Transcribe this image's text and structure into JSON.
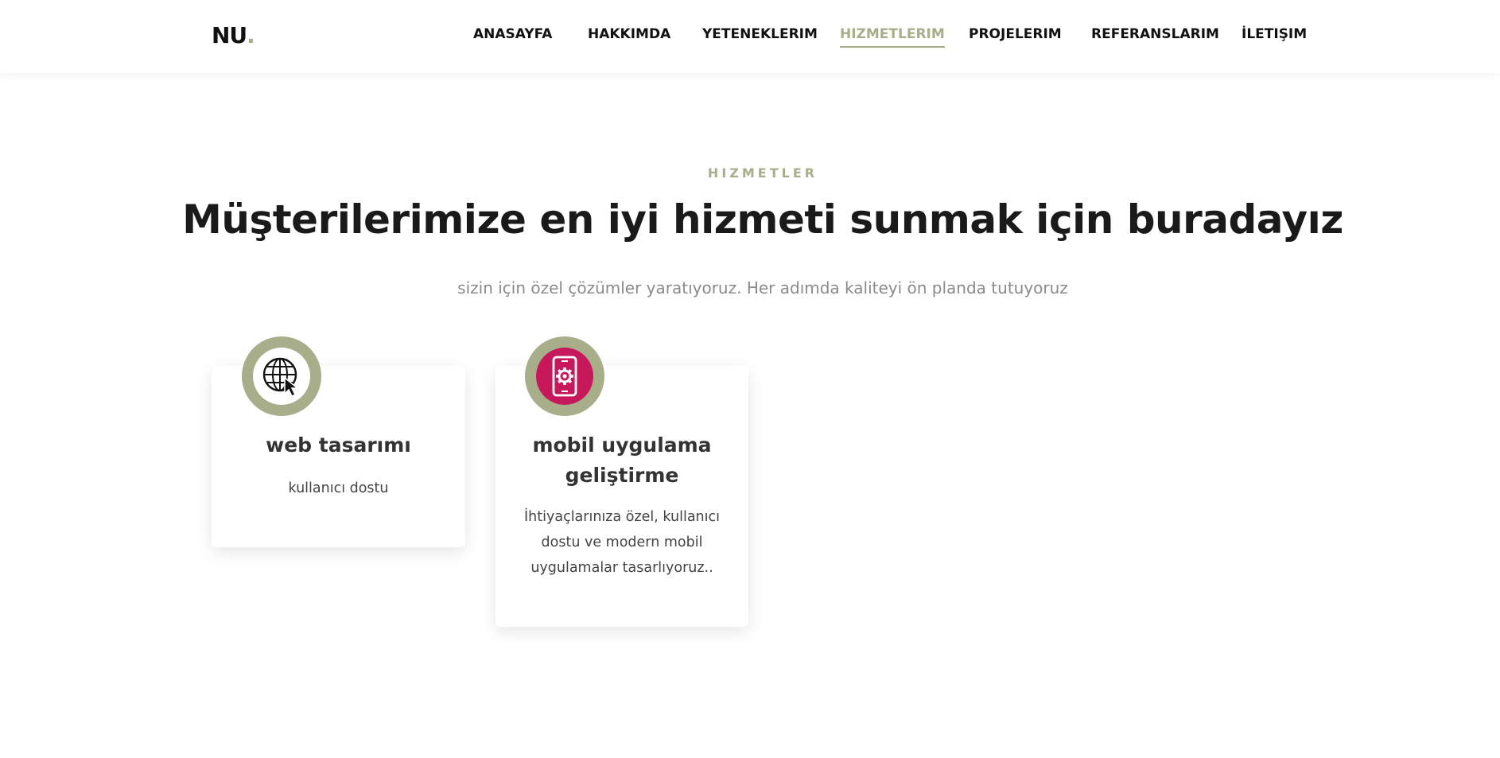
{
  "brand": {
    "logo_text": "NU",
    "logo_dot": ".",
    "accent_color": "#a8ad8a"
  },
  "nav": {
    "items": [
      {
        "label": "ANASAYFA"
      },
      {
        "label": "HAKKIMDA"
      },
      {
        "label": "YETENEKLERIM"
      },
      {
        "label": "HIZMETLERIM",
        "active": true
      },
      {
        "label": "PROJELERIM"
      },
      {
        "label": "REFERANSLARIM"
      },
      {
        "label": "İLETIŞIM"
      }
    ]
  },
  "section": {
    "eyebrow": "HIZMETLER",
    "headline": "Müşterilerimize en iyi hizmeti sunmak için buradayız",
    "subtitle": "sizin için özel çözümler yaratıyoruz. Her adımda kaliteyi ön planda tutuyoruz"
  },
  "services": [
    {
      "icon": "globe-cursor-icon",
      "title": "web tasarımı",
      "description": "kullanıcı dostu"
    },
    {
      "icon": "mobile-gear-icon",
      "title": "mobil uygulama geliştirme",
      "description": "İhtiyaçlarınıza özel, kullanıcı dostu ve modern mobil uygulamalar tasarlıyoruz.."
    }
  ],
  "colors": {
    "icon_ring": "#a8ad8a",
    "mobile_icon_bg": "#c6185a",
    "headline": "#1a1a1a",
    "subtitle": "#8a8a8a"
  }
}
